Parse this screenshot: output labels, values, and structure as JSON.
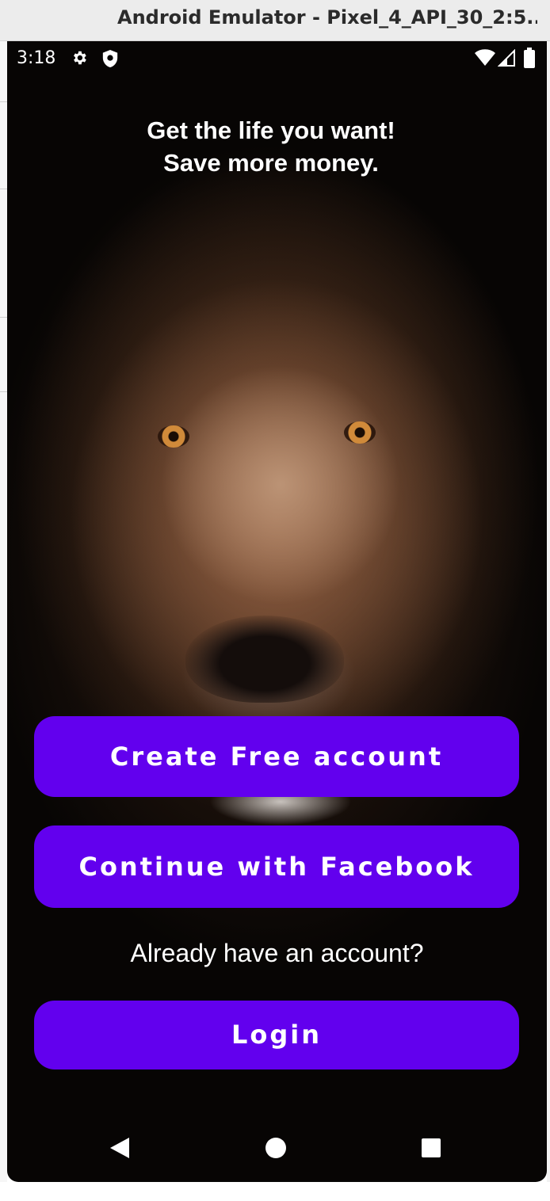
{
  "window": {
    "title": "Android Emulator - Pixel_4_API_30_2:5..."
  },
  "status_bar": {
    "time": "3:18",
    "icons": [
      "gear-icon",
      "shield-icon",
      "wifi-icon",
      "signal-icon",
      "battery-icon"
    ]
  },
  "screen": {
    "headline": "Get the life you want!\nSave more money.",
    "background": "lion-photo"
  },
  "buttons": {
    "create_account": "Create Free account",
    "facebook": "Continue with Facebook",
    "login": "Login"
  },
  "prompt": {
    "already_have_account": "Already have an account?"
  },
  "nav_bar": {
    "icons": [
      "back-icon",
      "home-icon",
      "recents-icon"
    ]
  },
  "colors": {
    "accent": "#6200ee",
    "text": "#ffffff"
  }
}
